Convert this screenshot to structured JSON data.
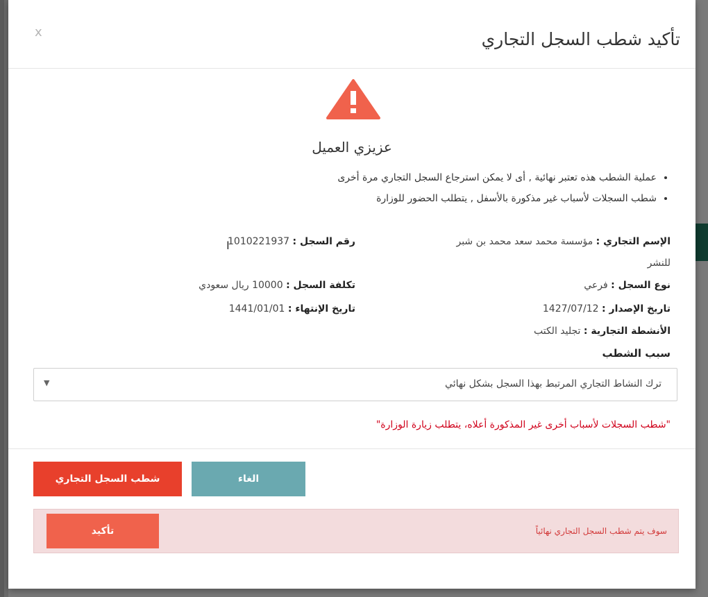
{
  "modal": {
    "title": "تأكيد شطب السجل التجاري",
    "close_glyph": "x",
    "greeting": "عزيزي العميل",
    "bullets": [
      "عملية الشطب هذه تعتبر نهائية , أى لا يمكن استرجاع السجل التجاري مرة أخرى",
      "شطب السجلات لأسباب غير مذكورة بالأسفل , يتطلب الحضور للوزارة"
    ],
    "fields": {
      "trade_name_label": "الإسم التجاري :",
      "trade_name_value": "مؤسسة محمد سعد محمد بن شبر",
      "trade_name_value_line2": "للنشر",
      "record_number_label": "رقم السجل :",
      "record_number_value": "1010221937",
      "record_type_label": "نوع السجل :",
      "record_type_value": "فرعي",
      "record_cost_label": "تكلفة السجل :",
      "record_cost_value": "10000 ريال سعودي",
      "issue_date_label": "تاريخ الإصدار :",
      "issue_date_value": "1427/07/12",
      "expiry_date_label": "تاريخ الإنتهاء :",
      "expiry_date_value": "1441/01/01",
      "activities_label": "الأنشطة التجارية :",
      "activities_value": "تجليد الكتب"
    },
    "reason_label": "سبب الشطب",
    "reason_selected": "ترك النشاط التجاري المرتبط بهذا السجل بشكل نهائي",
    "red_note": "\"شطب السجلات لأسباب أخرى غير المذكورة أعلاه، يتطلب زيارة الوزارة\"",
    "buttons": {
      "delete_label": "شطب السجل التجاري",
      "cancel_label": "الغاء",
      "confirm_label": "تأكيد"
    },
    "confirm_message": "سوف يتم شطب السجل التجاري نهائياً"
  },
  "colors": {
    "delete_button": "#e8402c",
    "cancel_button": "#6aa9b0",
    "confirm_button": "#f0624c",
    "confirm_box_bg": "#f3dcdd",
    "warning_icon": "#f0624c",
    "red_note": "#d0021b"
  },
  "icons": {
    "warning": "warning-triangle-icon",
    "dropdown": "caret-down-icon",
    "close": "close-icon"
  }
}
